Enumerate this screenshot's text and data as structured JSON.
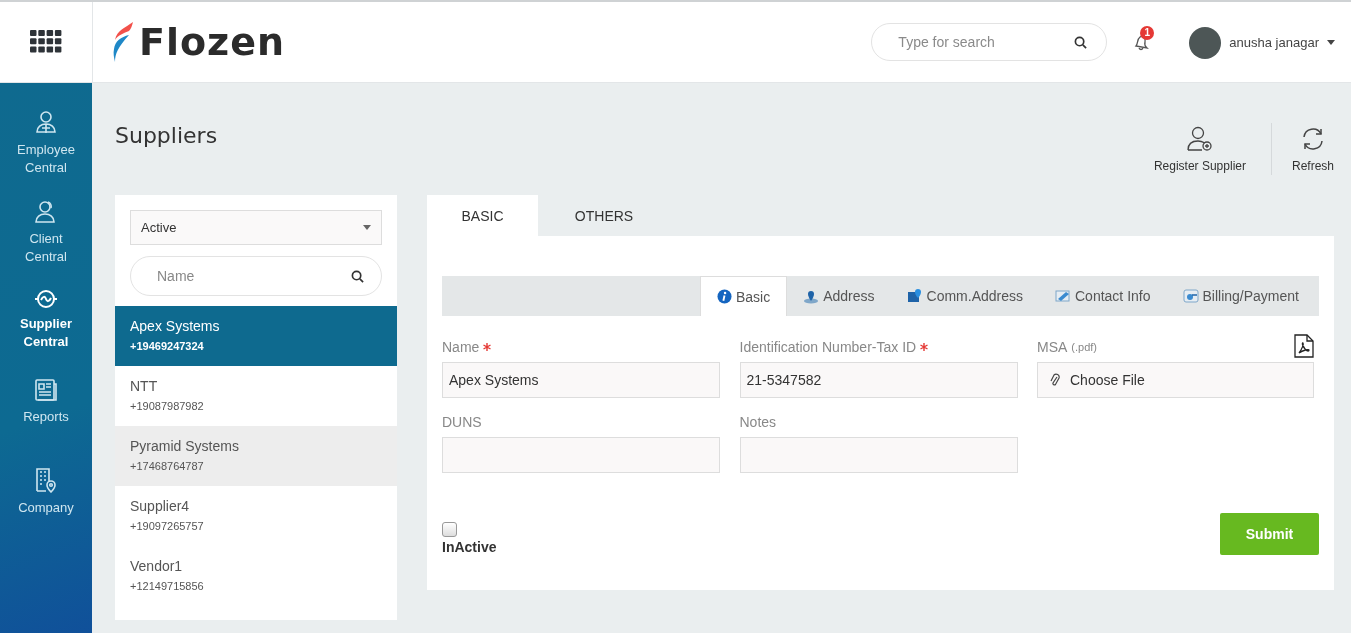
{
  "header": {
    "logo": "Flozen",
    "search": {
      "placeholder": "Type for search"
    },
    "notification_count": "1",
    "user": "anusha janagar"
  },
  "sidebar": {
    "items": [
      {
        "label": "Employee Central",
        "selected": false
      },
      {
        "label": "Client Central",
        "selected": false
      },
      {
        "label": "Supplier Central",
        "selected": true
      },
      {
        "label": "Reports",
        "selected": false
      },
      {
        "label": "Company",
        "selected": false
      }
    ]
  },
  "page_title": "Suppliers",
  "actions": [
    {
      "label": "Register Supplier"
    },
    {
      "label": "Refresh"
    }
  ],
  "suppliers": {
    "filter": "Active",
    "search": {
      "placeholder": "Name"
    },
    "items": [
      {
        "name": "Apex Systems",
        "phone": "+19469247324",
        "selected": true,
        "hovered": false
      },
      {
        "name": "NTT",
        "phone": "+19087987982",
        "selected": false,
        "hovered": false
      },
      {
        "name": "Pyramid Systems",
        "phone": "+17468764787",
        "selected": false,
        "hovered": true
      },
      {
        "name": "Supplier4",
        "phone": "+19097265757",
        "selected": false,
        "hovered": false
      },
      {
        "name": "Vendor1",
        "phone": "+12149715856",
        "selected": false,
        "hovered": false
      }
    ]
  },
  "tabs": [
    {
      "label": "BASIC",
      "selected": true
    },
    {
      "label": "OTHERS",
      "selected": false
    }
  ],
  "subtabs": [
    {
      "label": "Basic",
      "selected": true
    },
    {
      "label": "Address",
      "selected": false
    },
    {
      "label": "Comm.Address",
      "selected": false
    },
    {
      "label": "Contact Info",
      "selected": false
    },
    {
      "label": "Billing/Payment",
      "selected": false
    }
  ],
  "fields": [
    {
      "kind": "text",
      "label": "Name",
      "required": true,
      "value": "Apex Systems"
    },
    {
      "kind": "text",
      "label": "Identification Number-Tax ID",
      "required": true,
      "value": "21-5347582"
    },
    {
      "kind": "file",
      "label": "MSA",
      "hint": "(.pdf)",
      "required": false,
      "value": "Choose File"
    },
    {
      "kind": "text",
      "label": "DUNS",
      "required": false
    },
    {
      "kind": "text",
      "label": "Notes",
      "required": false
    }
  ],
  "inactive": {
    "label": "InActive",
    "checked": false
  },
  "submit": "Submit"
}
